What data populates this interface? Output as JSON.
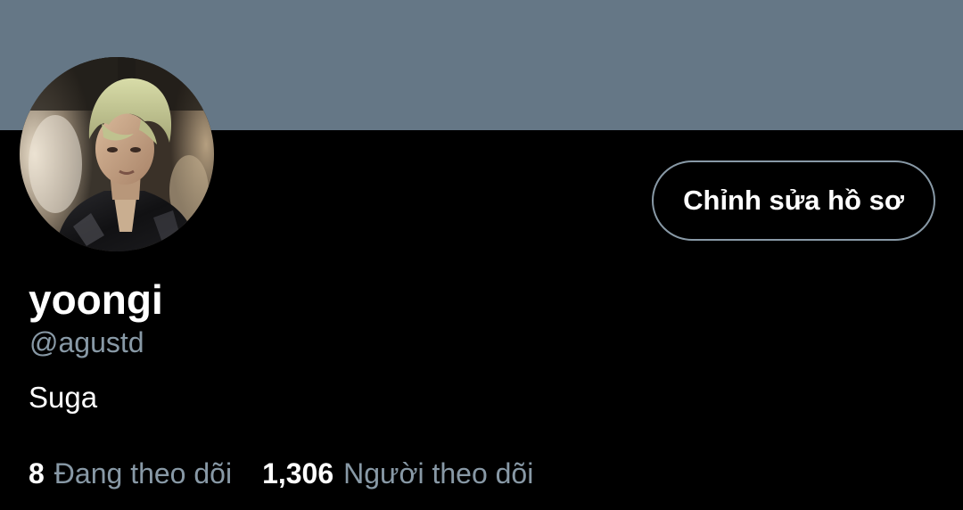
{
  "profile": {
    "display_name": "yoongi",
    "handle": "@agustd",
    "bio": "Suga",
    "avatar_description": "profile-photo"
  },
  "actions": {
    "edit_profile_label": "Chỉnh sửa hồ sơ"
  },
  "stats": {
    "following_count": "8",
    "following_label": "Đang theo dõi",
    "followers_count": "1,306",
    "followers_label": "Người theo dõi"
  },
  "colors": {
    "banner": "#657786",
    "background": "#000000",
    "primary_text": "#ffffff",
    "secondary_text": "#8899a6",
    "button_border": "#8899a6"
  }
}
